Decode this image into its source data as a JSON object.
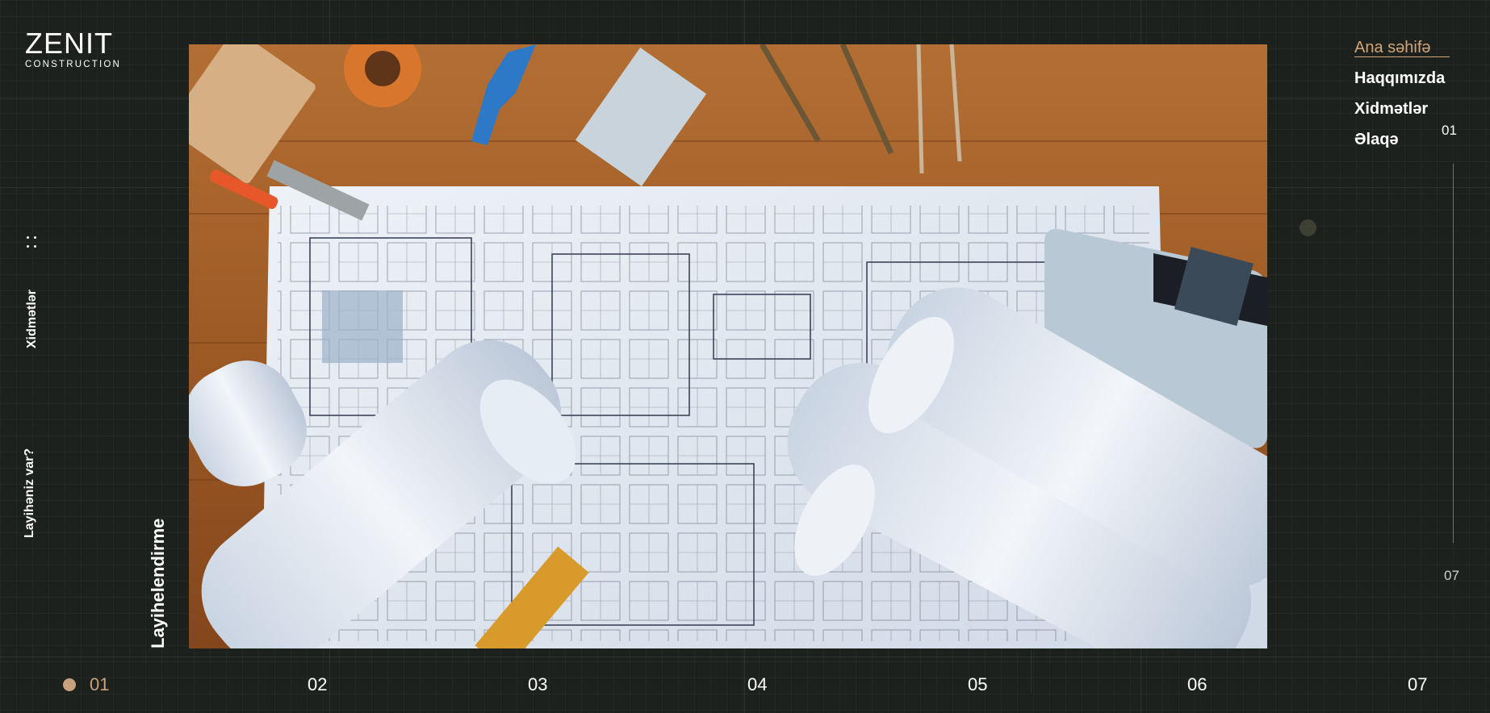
{
  "brand": {
    "name": "ZENIT",
    "subtitle": "CONSTRUCTION"
  },
  "nav": {
    "items": [
      {
        "label": "Ana səhifə",
        "active": true
      },
      {
        "label": "Haqqımızda",
        "active": false
      },
      {
        "label": "Xidmətlər",
        "active": false
      },
      {
        "label": "Əlaqə",
        "active": false
      }
    ]
  },
  "side": {
    "services": "Xidmətlər",
    "project_question": "Layihəniz var?",
    "heading": "Layihelendirme"
  },
  "slider": {
    "current_top": "01",
    "total": "07",
    "pages": [
      "01",
      "02",
      "03",
      "04",
      "05",
      "06",
      "07"
    ]
  },
  "colors": {
    "background": "#1c211d",
    "accent": "#d2a478",
    "dot": "#c8a07e"
  },
  "hero": {
    "image": "architectural blueprints on wooden desk with drafting tools"
  }
}
